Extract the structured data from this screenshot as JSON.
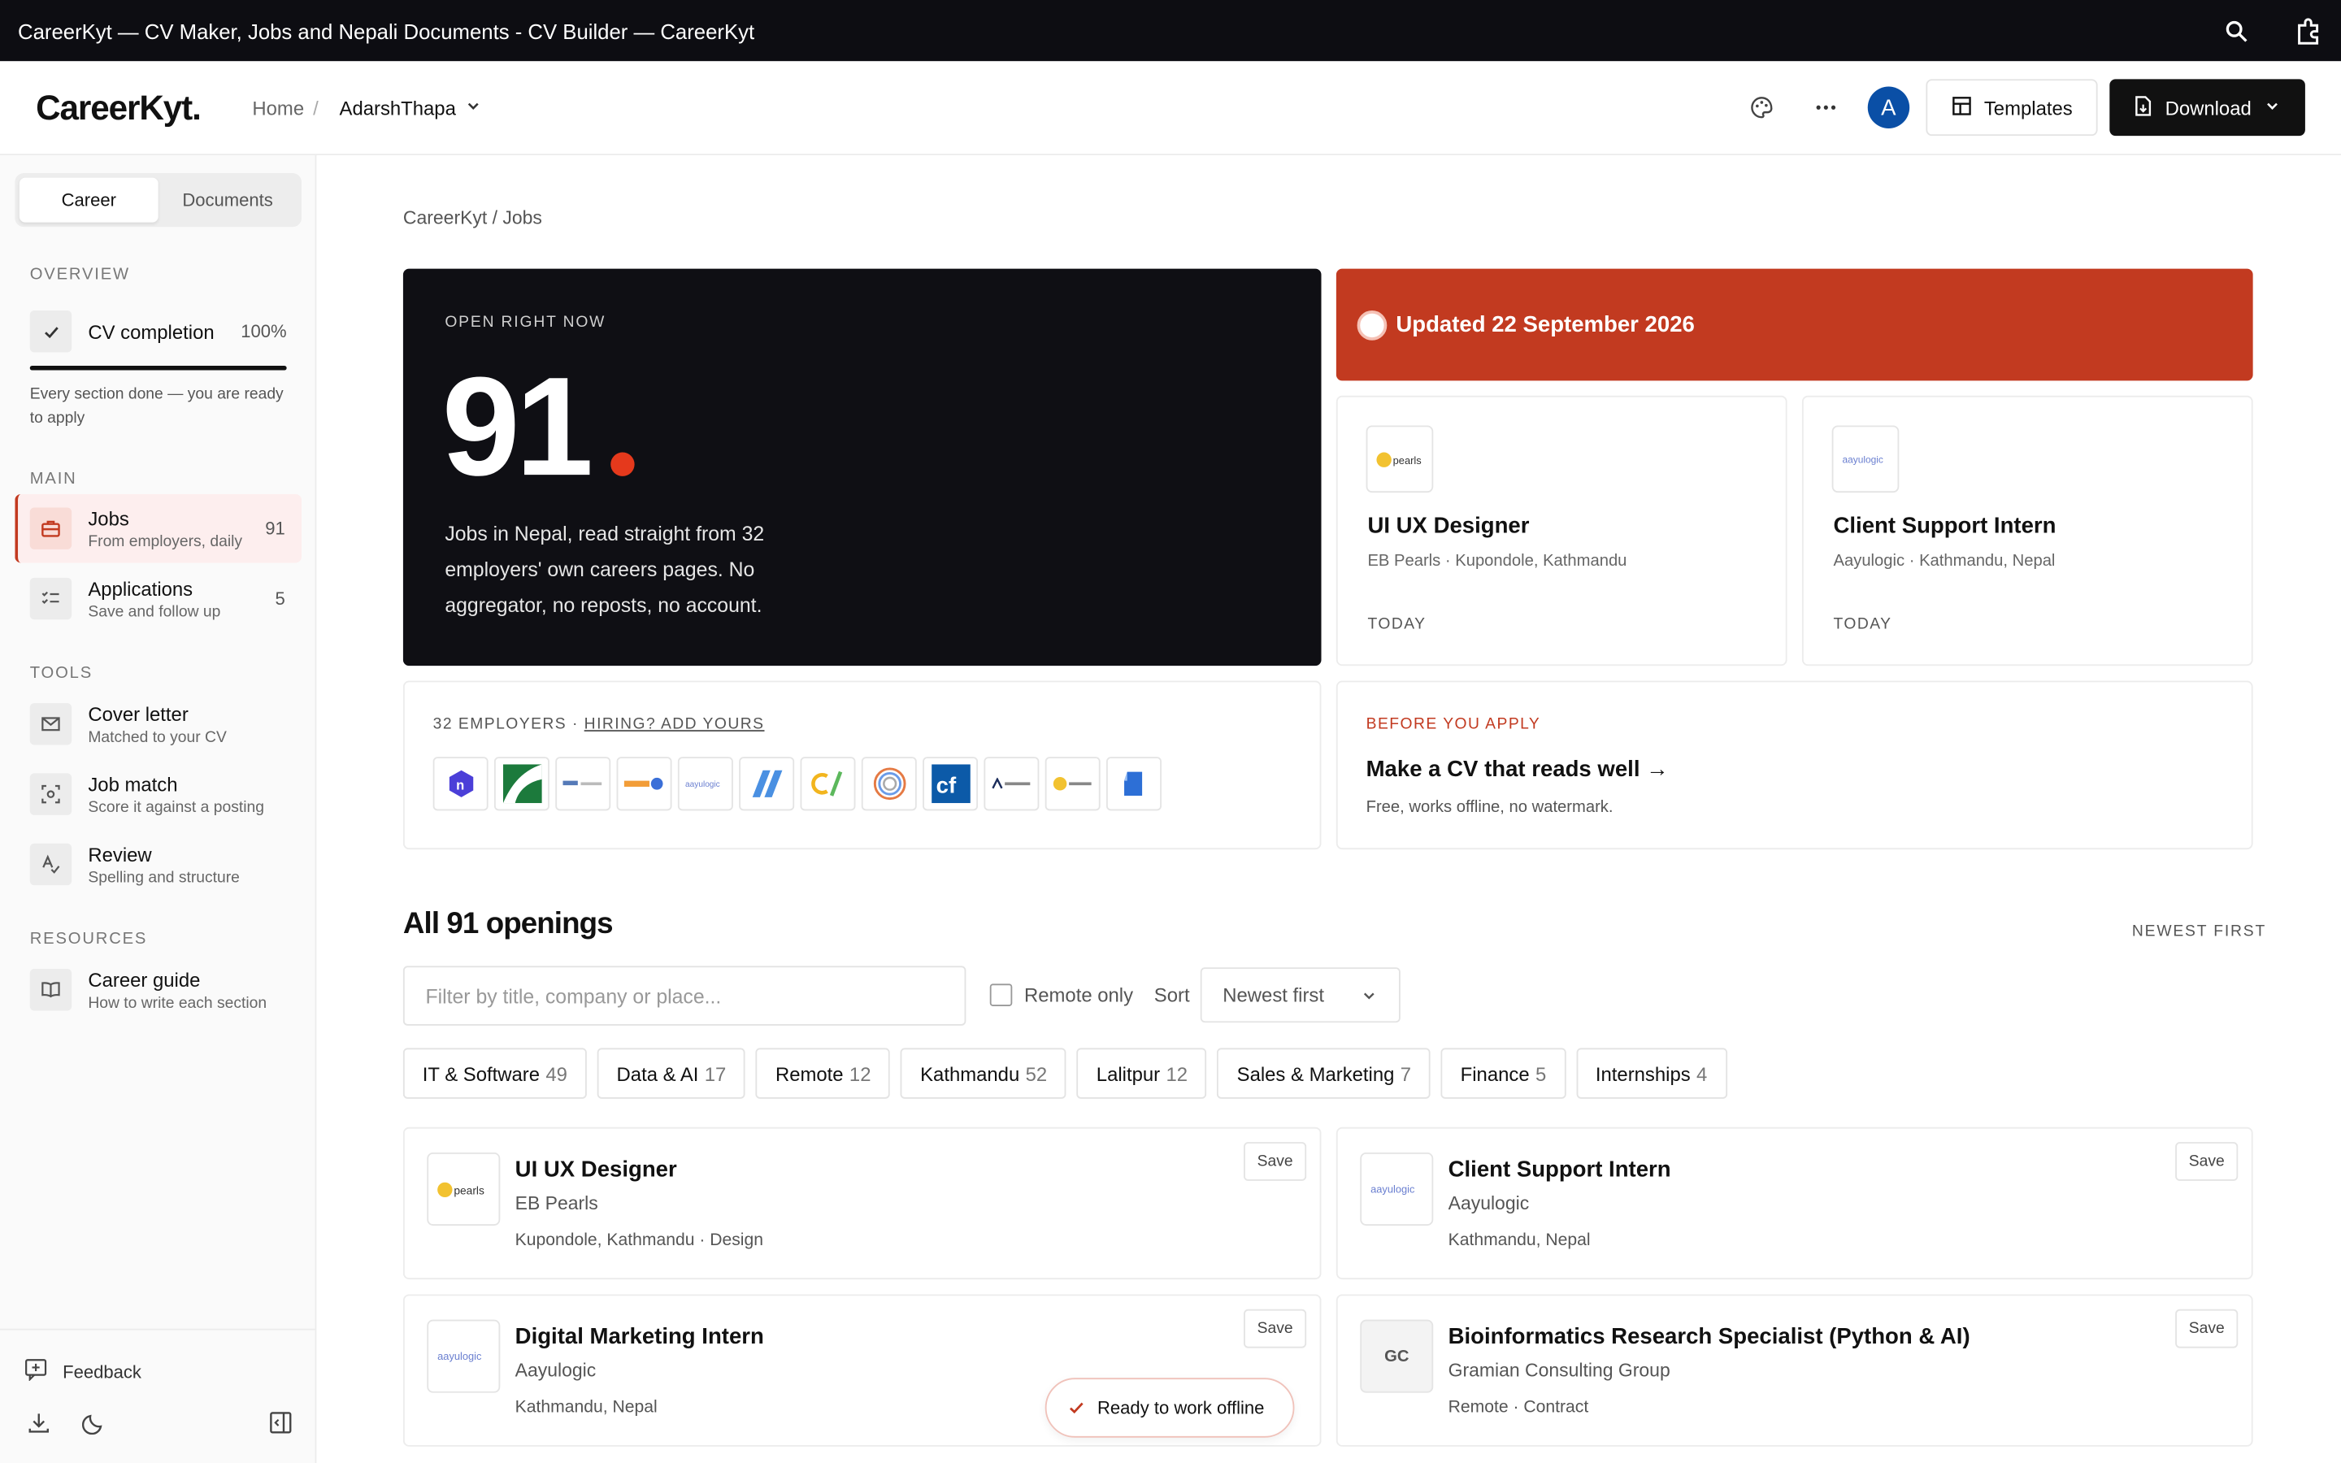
{
  "window": {
    "title": "CareerKyt — CV Maker, Jobs and Nepali Documents - CV Builder — CareerKyt"
  },
  "header": {
    "logo": "CareerKyt.",
    "breadcrumb_home": "Home",
    "breadcrumb_sep": "/",
    "project": "AdarshThapa",
    "avatar_letter": "A",
    "templates_label": "Templates",
    "download_label": "Download"
  },
  "sidebar": {
    "tabs": [
      "Career",
      "Documents"
    ],
    "overview_label": "OVERVIEW",
    "cv_completion": {
      "label": "CV completion",
      "value": "100%",
      "progress": 1.0,
      "note": "Every section done — you are ready to apply"
    },
    "main_label": "MAIN",
    "main_items": [
      {
        "title": "Jobs",
        "sub": "From employers, daily",
        "count": "91"
      },
      {
        "title": "Applications",
        "sub": "Save and follow up",
        "count": "5"
      }
    ],
    "tools_label": "TOOLS",
    "tools_items": [
      {
        "title": "Cover letter",
        "sub": "Matched to your CV"
      },
      {
        "title": "Job match",
        "sub": "Score it against a posting"
      },
      {
        "title": "Review",
        "sub": "Spelling and structure"
      }
    ],
    "resources_label": "RESOURCES",
    "resources_items": [
      {
        "title": "Career guide",
        "sub": "How to write each section"
      }
    ],
    "feedback_label": "Feedback"
  },
  "main": {
    "breadcrumb": "CareerKyt / Jobs",
    "hero": {
      "label": "OPEN RIGHT NOW",
      "number": "91",
      "desc": "Jobs in Nepal, read straight from 32 employers' own careers pages. No aggregator, no reposts, no account."
    },
    "updated": "Updated 22 September 2026",
    "featured": [
      {
        "logo": "pearls",
        "title": "UI UX Designer",
        "company": "EB Pearls · Kupondole, Kathmandu",
        "when": "TODAY"
      },
      {
        "logo": "aayulogic",
        "title": "Client Support Intern",
        "company": "Aayulogic · Kathmandu, Nepal",
        "when": "TODAY"
      }
    ],
    "employers": {
      "count_label": "32 EMPLOYERS · ",
      "link": "HIRING? ADD YOURS"
    },
    "before_apply": {
      "label": "BEFORE YOU APPLY",
      "heading": "Make a CV that reads well →",
      "sub": "Free, works offline, no watermark."
    },
    "openings_title": "All 91 openings",
    "sort_hint": "NEWEST FIRST",
    "filter_placeholder": "Filter by title, company or place...",
    "remote_only": "Remote only",
    "sort_label": "Sort",
    "sort_value": "Newest first",
    "chips": [
      {
        "label": "IT & Software",
        "count": "49"
      },
      {
        "label": "Data & AI",
        "count": "17"
      },
      {
        "label": "Remote",
        "count": "12"
      },
      {
        "label": "Kathmandu",
        "count": "52"
      },
      {
        "label": "Lalitpur",
        "count": "12"
      },
      {
        "label": "Sales & Marketing",
        "count": "7"
      },
      {
        "label": "Finance",
        "count": "5"
      },
      {
        "label": "Internships",
        "count": "4"
      }
    ],
    "listings": [
      {
        "logo": "pearls",
        "title": "UI UX Designer",
        "company": "EB Pearls",
        "meta": "Kupondole, Kathmandu · Design",
        "save": "Save"
      },
      {
        "logo": "aayulogic",
        "title": "Client Support Intern",
        "company": "Aayulogic",
        "meta": "Kathmandu, Nepal",
        "save": "Save"
      },
      {
        "logo": "aayulogic",
        "title": "Digital Marketing Intern",
        "company": "Aayulogic",
        "meta": "Kathmandu, Nepal",
        "save": "Save"
      },
      {
        "logo": "GC",
        "title": "Bioinformatics Research Specialist (Python & AI)",
        "company": "Gramian Consulting Group",
        "meta": "Remote · Contract",
        "save": "Save"
      }
    ],
    "toast": "Ready to work offline",
    "colors": {
      "accent": "#c23a20",
      "dark": "#0f0f14",
      "hero_dot": "#e5391c",
      "avatar": "#0a4fa6"
    }
  }
}
